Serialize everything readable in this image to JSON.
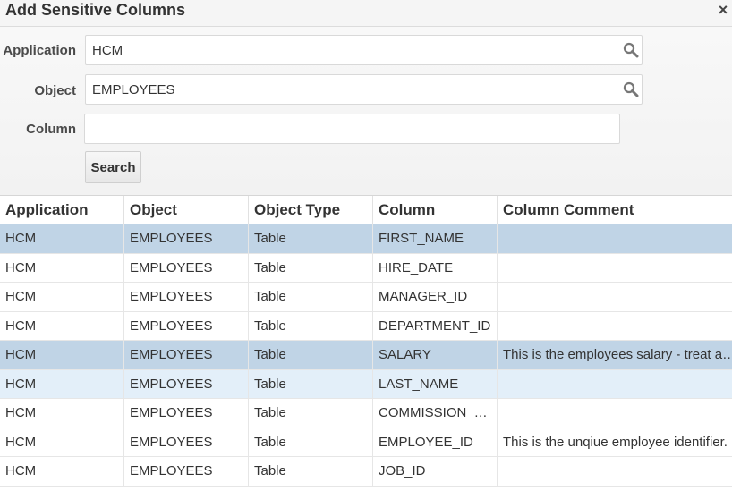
{
  "dialog": {
    "title": "Add Sensitive Columns",
    "close_label": "×"
  },
  "form": {
    "application": {
      "label": "Application",
      "value": "HCM",
      "icon": "search-icon"
    },
    "object": {
      "label": "Object",
      "value": "EMPLOYEES",
      "icon": "search-icon"
    },
    "column": {
      "label": "Column",
      "value": ""
    },
    "search_button": "Search"
  },
  "table": {
    "columns": [
      "Application",
      "Object",
      "Object Type",
      "Column",
      "Column Comment"
    ],
    "rows": [
      {
        "application": "HCM",
        "object": "EMPLOYEES",
        "object_type": "Table",
        "column": "FIRST_NAME",
        "comment": "",
        "state": "selected"
      },
      {
        "application": "HCM",
        "object": "EMPLOYEES",
        "object_type": "Table",
        "column": "HIRE_DATE",
        "comment": "",
        "state": "normal"
      },
      {
        "application": "HCM",
        "object": "EMPLOYEES",
        "object_type": "Table",
        "column": "MANAGER_ID",
        "comment": "",
        "state": "normal"
      },
      {
        "application": "HCM",
        "object": "EMPLOYEES",
        "object_type": "Table",
        "column": "DEPARTMENT_ID",
        "comment": "",
        "state": "normal"
      },
      {
        "application": "HCM",
        "object": "EMPLOYEES",
        "object_type": "Table",
        "column": "SALARY",
        "comment": "This is the employees salary - treat a…",
        "state": "selected"
      },
      {
        "application": "HCM",
        "object": "EMPLOYEES",
        "object_type": "Table",
        "column": "LAST_NAME",
        "comment": "",
        "state": "hover"
      },
      {
        "application": "HCM",
        "object": "EMPLOYEES",
        "object_type": "Table",
        "column": "COMMISSION_…",
        "comment": "",
        "state": "normal"
      },
      {
        "application": "HCM",
        "object": "EMPLOYEES",
        "object_type": "Table",
        "column": "EMPLOYEE_ID",
        "comment": "This is the unqiue employee identifier.",
        "state": "normal"
      },
      {
        "application": "HCM",
        "object": "EMPLOYEES",
        "object_type": "Table",
        "column": "JOB_ID",
        "comment": "",
        "state": "normal"
      }
    ]
  },
  "colors": {
    "selected_row": "#c0d4e6",
    "hover_row": "#e3eff9",
    "form_background": "#f5f5f5"
  }
}
